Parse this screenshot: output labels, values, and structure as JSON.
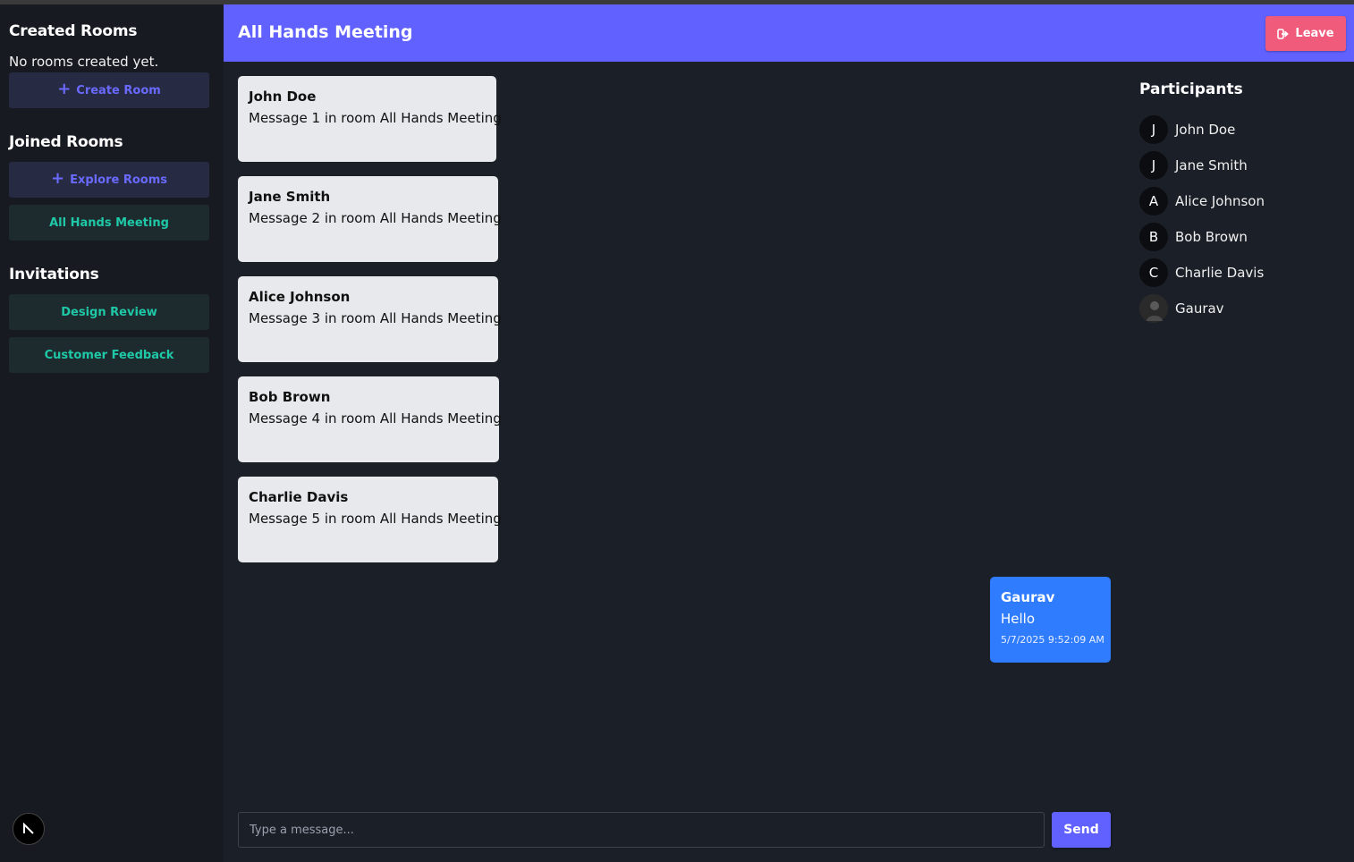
{
  "sidebar": {
    "created_title": "Created Rooms",
    "no_rooms_text": "No rooms created yet.",
    "create_room_label": "Create Room",
    "joined_title": "Joined Rooms",
    "explore_rooms_label": "Explore Rooms",
    "joined_rooms": [
      "All Hands Meeting"
    ],
    "invitations_title": "Invitations",
    "invitations": [
      "Design Review",
      "Customer Feedback"
    ]
  },
  "header": {
    "room_title": "All Hands Meeting",
    "leave_label": "Leave"
  },
  "messages": [
    {
      "author": "John Doe",
      "text": "Message 1 in room All Hands Meeting"
    },
    {
      "author": "Jane Smith",
      "text": "Message 2 in room All Hands Meeting"
    },
    {
      "author": "Alice Johnson",
      "text": "Message 3 in room All Hands Meeting"
    },
    {
      "author": "Bob Brown",
      "text": "Message 4 in room All Hands Meeting"
    },
    {
      "author": "Charlie Davis",
      "text": "Message 5 in room All Hands Meeting"
    }
  ],
  "own_message": {
    "author": "Gaurav",
    "text": "Hello",
    "timestamp": "5/7/2025 9:52:09 AM"
  },
  "participants": {
    "title": "Participants",
    "list": [
      {
        "initial": "J",
        "name": "John Doe"
      },
      {
        "initial": "J",
        "name": "Jane Smith"
      },
      {
        "initial": "A",
        "name": "Alice Johnson"
      },
      {
        "initial": "B",
        "name": "Bob Brown"
      },
      {
        "initial": "C",
        "name": "Charlie Davis"
      },
      {
        "initial": "",
        "name": "Gaurav"
      }
    ]
  },
  "composer": {
    "placeholder": "Type a message...",
    "send_label": "Send"
  },
  "colors": {
    "accent": "#6161ff",
    "leave": "#f05b7c",
    "own_bubble": "#2f7cff",
    "teal_text": "#1fc8a7"
  }
}
